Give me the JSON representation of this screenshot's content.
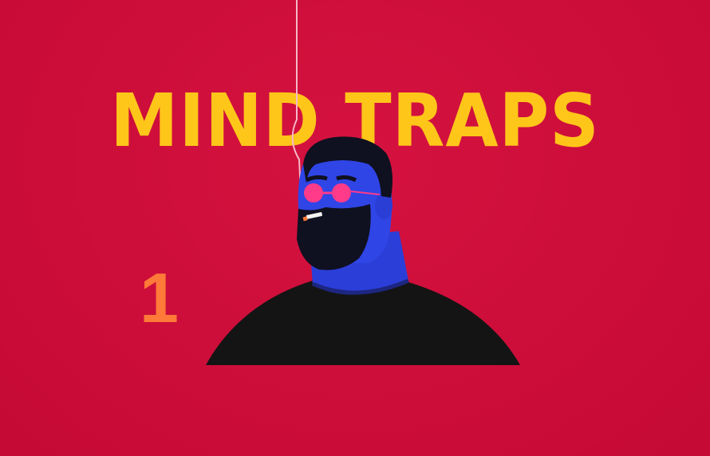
{
  "title": "MIND TRAPS",
  "episode_number": "1",
  "colors": {
    "background": "#cc0d39",
    "title": "#ffc61a",
    "episode_number": "#ff7a38",
    "skin": "#2f45e6",
    "hair": "#0f1020",
    "shirt": "#141414",
    "glasses": "#ff3b8a",
    "smoke": "#f5b8c8"
  },
  "icons": [
    "hanging-string",
    "bearded-man-illustration",
    "cigarette-icon"
  ]
}
